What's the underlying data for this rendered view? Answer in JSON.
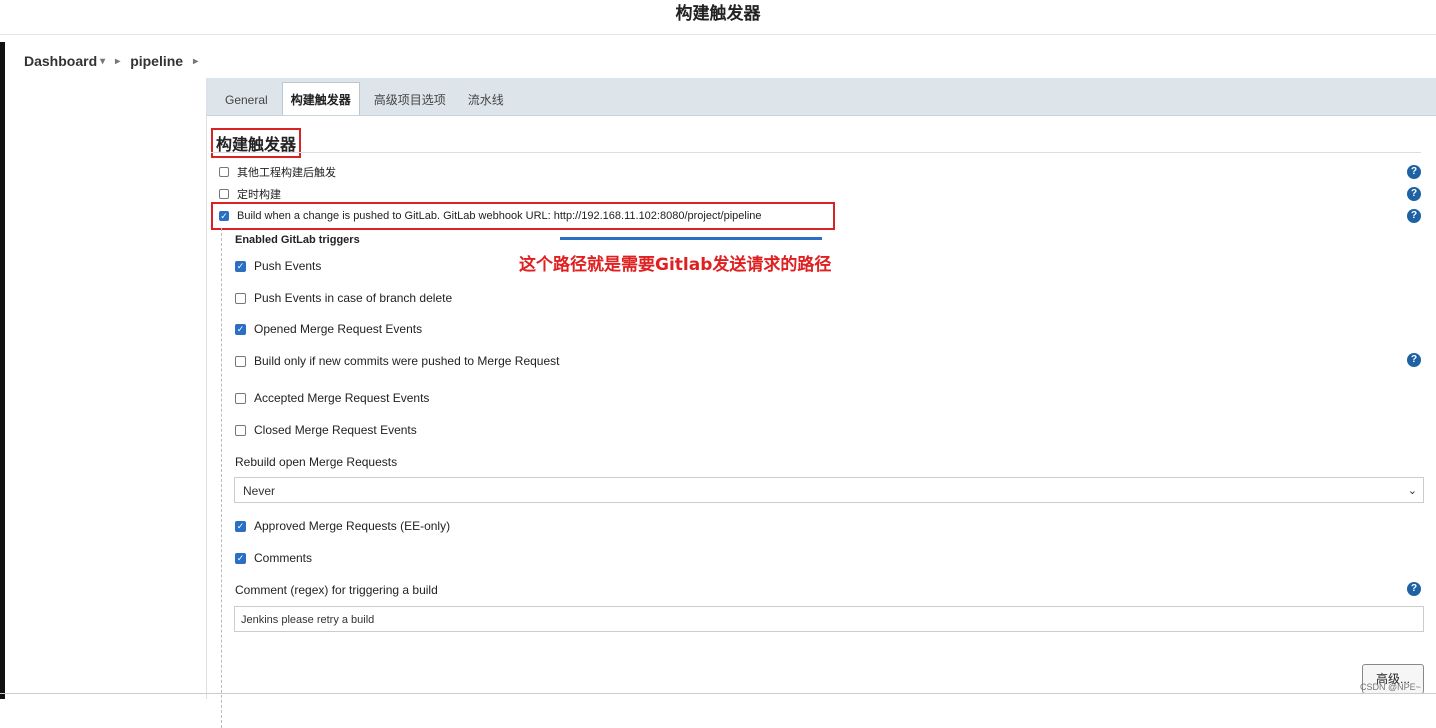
{
  "page_title": "构建触发器",
  "breadcrumb": {
    "dashboard": "Dashboard",
    "pipeline": "pipeline"
  },
  "tabs": [
    {
      "label": "General"
    },
    {
      "label": "构建触发器"
    },
    {
      "label": "高级项目选项"
    },
    {
      "label": "流水线"
    }
  ],
  "section_title": "构建触发器",
  "triggers": {
    "other_project": "其他工程构建后触发",
    "scheduled": "定时构建",
    "gitlab": "Build when a change is pushed to GitLab. GitLab webhook URL: http://192.168.11.102:8080/project/pipeline"
  },
  "annotation": "这个路径就是需要Gitlab发送请求的路径",
  "gitlab_triggers": {
    "heading": "Enabled GitLab triggers",
    "push_events": "Push Events",
    "push_branch_delete": "Push Events in case of branch delete",
    "opened_mr": "Opened Merge Request Events",
    "build_only_new_commits": "Build only if new commits were pushed to Merge Request",
    "accepted_mr": "Accepted Merge Request Events",
    "closed_mr": "Closed Merge Request Events",
    "rebuild_label": "Rebuild open Merge Requests",
    "rebuild_value": "Never",
    "approved_mr": "Approved Merge Requests (EE-only)",
    "comments": "Comments",
    "comment_regex_label": "Comment (regex) for triggering a build",
    "comment_regex_value": "Jenkins please retry a build"
  },
  "advanced_button": "高级...",
  "watermark": "CSDN @NPE~",
  "colors": {
    "accent": "#2a6fc4",
    "highlight": "#d62424",
    "help": "#1e62a4"
  }
}
